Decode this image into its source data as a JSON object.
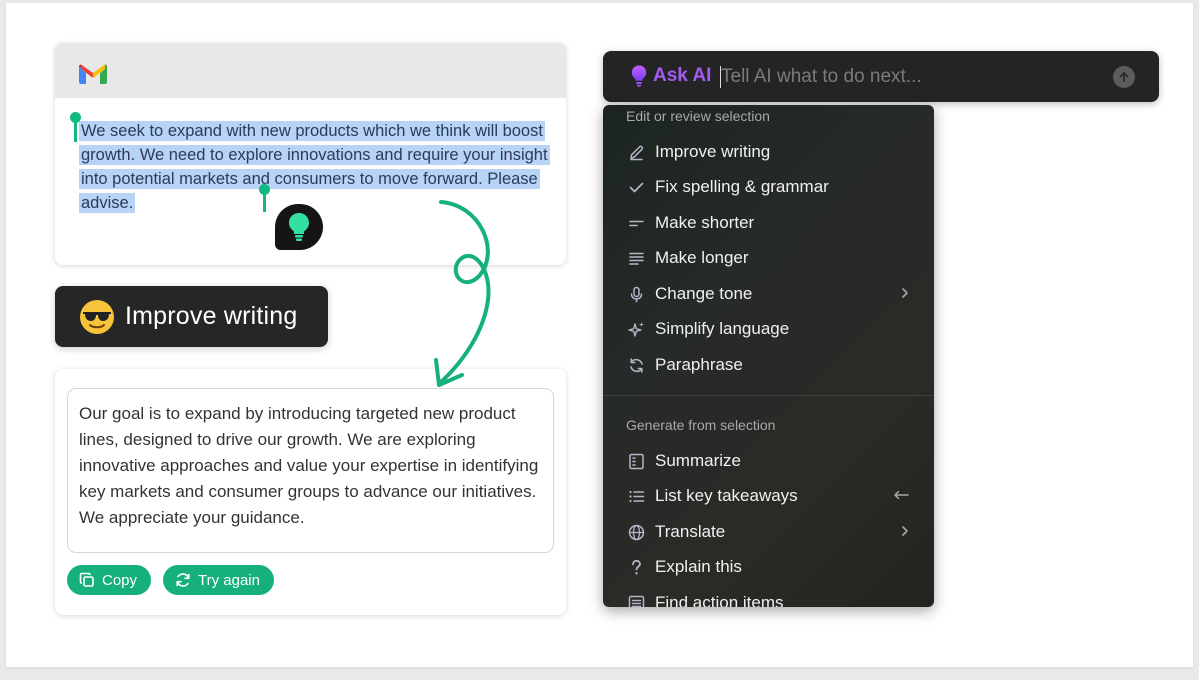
{
  "email": {
    "selected_text": "We seek to expand with new products which we think will boost growth. We need to explore innovations and require your insight into potential markets and consumers to move forward. Please advise."
  },
  "action_pill": {
    "label": "Improve writing",
    "emoji": "😎"
  },
  "result": {
    "text": "Our goal is to expand by introducing targeted new product lines, designed to drive our growth. We are exploring innovative approaches and value your expertise in identifying key markets and consumer groups to advance our initiatives. We appreciate your guidance.",
    "copy_label": "Copy",
    "try_again_label": "Try again"
  },
  "ask_ai": {
    "label": "Ask AI",
    "placeholder": "Tell AI what to do next..."
  },
  "menu": {
    "section1": "Edit or review selection",
    "section2": "Generate from selection",
    "items": [
      {
        "label": "Improve writing",
        "icon": "pencil-icon"
      },
      {
        "label": "Fix spelling & grammar",
        "icon": "check-icon"
      },
      {
        "label": "Make shorter",
        "icon": "short-lines-icon"
      },
      {
        "label": "Make longer",
        "icon": "long-lines-icon"
      },
      {
        "label": "Change tone",
        "icon": "microphone-icon",
        "right": "chevron-right-icon"
      },
      {
        "label": "Simplify language",
        "icon": "sparkle-icon"
      },
      {
        "label": "Paraphrase",
        "icon": "refresh-icon"
      },
      {
        "label": "Summarize",
        "icon": "document-icon"
      },
      {
        "label": "List key takeaways",
        "icon": "list-icon",
        "right": "return-icon"
      },
      {
        "label": "Translate",
        "icon": "globe-icon",
        "right": "chevron-right-icon"
      },
      {
        "label": "Explain this",
        "icon": "question-icon"
      },
      {
        "label": "Find action items",
        "icon": "checklist-icon"
      }
    ]
  },
  "colors": {
    "accent_green": "#15b07c",
    "ask_ai_purple": "#a45cf0",
    "selection_blue": "#b7d3f5"
  }
}
